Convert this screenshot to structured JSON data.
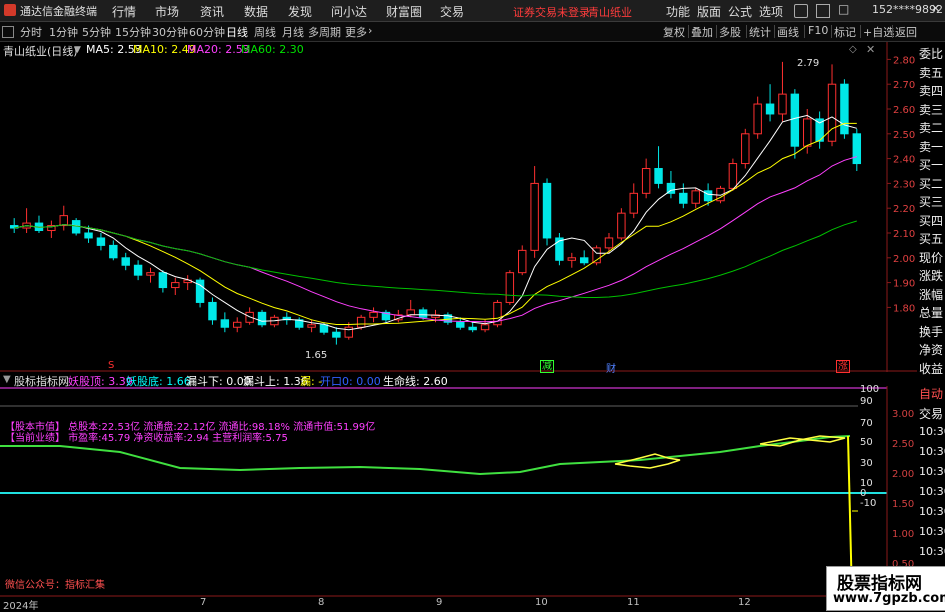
{
  "titlebar": {
    "app_name": "通达信金融终端",
    "menu": [
      "行情",
      "市场",
      "资讯",
      "数据",
      "发现",
      "问小达",
      "财富圈",
      "交易"
    ],
    "notice_login": "证券交易未登录",
    "notice_stock": "青山纸业",
    "right_menu": [
      "功能",
      "版面",
      "公式",
      "选项"
    ],
    "user": "152****9892"
  },
  "toolbar": {
    "periods": [
      "分时",
      "1分钟",
      "5分钟",
      "15分钟",
      "30分钟",
      "60分钟",
      "日线",
      "周线",
      "月线",
      "多周期",
      "更多"
    ],
    "active_period": "日线",
    "right_buttons": [
      "复权",
      "叠加",
      "多股",
      "统计",
      "画线",
      "F10",
      "标记",
      "+自选",
      "返回"
    ]
  },
  "main_chart": {
    "stock_title": "青山纸业(日线)",
    "ma_legend": [
      {
        "label": "MA5: 2.53",
        "color": "#ffffff"
      },
      {
        "label": "MA10: 2.49",
        "color": "#ffff00"
      },
      {
        "label": "MA20: 2.53",
        "color": "#ff40ff"
      },
      {
        "label": "MA60: 2.30",
        "color": "#00e000"
      }
    ],
    "price_axis": [
      "2.80",
      "2.70",
      "2.60",
      "2.50",
      "2.40",
      "2.30",
      "2.20",
      "2.10",
      "2.00",
      "1.90",
      "1.80"
    ],
    "max_marker": "2.79",
    "min_marker": "1.65",
    "markers": [
      {
        "text": "S",
        "color": "#ff3030"
      },
      {
        "text": "减",
        "color": "#30ff30"
      },
      {
        "text": "财",
        "color": "#5080ff"
      },
      {
        "text": "涨",
        "color": "#ff3030"
      }
    ]
  },
  "sub_chart": {
    "title": "股标指标网",
    "legend": [
      {
        "label": "妖股顶: 3.39",
        "color": "#ff40ff"
      },
      {
        "label": "妖股底: 1.66",
        "color": "#00ffff"
      },
      {
        "label": "漏斗下: 0.00",
        "color": "#ffffff"
      },
      {
        "label": "漏斗上: 1.36",
        "color": "#ffffff"
      },
      {
        "label": "漏: -",
        "color": "#ffff00"
      },
      {
        "label": "开口0: 0.00",
        "color": "#3060ff"
      },
      {
        "label": "生命线: 2.60",
        "color": "#ffffff"
      }
    ],
    "scale_left": [
      "100",
      "90",
      "70",
      "50",
      "30",
      "10",
      "0",
      "-10"
    ],
    "scale_right": [
      "3.00",
      "2.50",
      "2.00",
      "1.50",
      "1.00",
      "0.50"
    ],
    "info_lines": [
      "【股本市值】 总股本:22.53亿 流通盘:22.12亿 流通比:98.18% 流通市值:51.99亿",
      "【当前业绩】 市盈率:45.79 净资收益率:2.94 主营利润率:5.75"
    ],
    "footer_wechat": "微信公众号：指标汇集"
  },
  "right_panel": {
    "items": [
      "委比",
      "卖五",
      "卖四",
      "卖三",
      "卖二",
      "卖一",
      "买一",
      "买二",
      "买三",
      "买四",
      "买五",
      "现价",
      "涨跌",
      "涨幅",
      "总量",
      "换手",
      "净资",
      "收益"
    ],
    "lower_items": [
      "自动",
      "交易",
      "10:30",
      "10:30",
      "10:30",
      "10:30",
      "10:30",
      "10:30",
      "10:30",
      "10:30",
      "10:30"
    ]
  },
  "date_axis": [
    "2024年",
    "7",
    "8",
    "9",
    "10",
    "11",
    "12"
  ],
  "watermark": {
    "title": "股票指标网",
    "url": "www.7gpzb.com"
  },
  "chart_data": {
    "type": "candlestick",
    "title": "青山纸业(日线)",
    "ylim": [
      1.6,
      2.85
    ],
    "ohlc_approx": [
      [
        2.13,
        2.16,
        2.1,
        2.12
      ],
      [
        2.12,
        2.2,
        2.1,
        2.14
      ],
      [
        2.14,
        2.17,
        2.1,
        2.11
      ],
      [
        2.11,
        2.15,
        2.08,
        2.13
      ],
      [
        2.13,
        2.21,
        2.11,
        2.17
      ],
      [
        2.15,
        2.16,
        2.09,
        2.1
      ],
      [
        2.1,
        2.13,
        2.06,
        2.08
      ],
      [
        2.08,
        2.1,
        2.03,
        2.05
      ],
      [
        2.05,
        2.07,
        1.99,
        2.0
      ],
      [
        2.0,
        2.02,
        1.95,
        1.97
      ],
      [
        1.97,
        1.99,
        1.91,
        1.93
      ],
      [
        1.93,
        1.96,
        1.9,
        1.94
      ],
      [
        1.94,
        1.95,
        1.86,
        1.88
      ],
      [
        1.88,
        1.92,
        1.85,
        1.9
      ],
      [
        1.9,
        1.93,
        1.87,
        1.91
      ],
      [
        1.91,
        1.92,
        1.8,
        1.82
      ],
      [
        1.82,
        1.84,
        1.73,
        1.75
      ],
      [
        1.75,
        1.78,
        1.7,
        1.72
      ],
      [
        1.72,
        1.76,
        1.7,
        1.74
      ],
      [
        1.74,
        1.8,
        1.73,
        1.78
      ],
      [
        1.78,
        1.79,
        1.72,
        1.73
      ],
      [
        1.73,
        1.77,
        1.72,
        1.76
      ],
      [
        1.76,
        1.78,
        1.73,
        1.75
      ],
      [
        1.75,
        1.76,
        1.71,
        1.72
      ],
      [
        1.72,
        1.75,
        1.7,
        1.73
      ],
      [
        1.73,
        1.74,
        1.69,
        1.7
      ],
      [
        1.7,
        1.72,
        1.65,
        1.68
      ],
      [
        1.68,
        1.74,
        1.67,
        1.72
      ],
      [
        1.72,
        1.77,
        1.71,
        1.76
      ],
      [
        1.76,
        1.8,
        1.74,
        1.78
      ],
      [
        1.78,
        1.79,
        1.74,
        1.75
      ],
      [
        1.75,
        1.79,
        1.74,
        1.77
      ],
      [
        1.77,
        1.83,
        1.76,
        1.79
      ],
      [
        1.79,
        1.8,
        1.75,
        1.76
      ],
      [
        1.76,
        1.79,
        1.74,
        1.77
      ],
      [
        1.77,
        1.78,
        1.73,
        1.74
      ],
      [
        1.74,
        1.76,
        1.71,
        1.72
      ],
      [
        1.72,
        1.74,
        1.7,
        1.71
      ],
      [
        1.71,
        1.75,
        1.7,
        1.73
      ],
      [
        1.73,
        1.83,
        1.72,
        1.82
      ],
      [
        1.82,
        1.95,
        1.81,
        1.94
      ],
      [
        1.94,
        2.05,
        1.93,
        2.03
      ],
      [
        2.03,
        2.37,
        2.0,
        2.3
      ],
      [
        2.3,
        2.32,
        2.05,
        2.08
      ],
      [
        2.08,
        2.1,
        1.97,
        1.99
      ],
      [
        1.99,
        2.02,
        1.96,
        2.0
      ],
      [
        2.0,
        2.03,
        1.97,
        1.98
      ],
      [
        1.98,
        2.05,
        1.97,
        2.04
      ],
      [
        2.04,
        2.1,
        2.02,
        2.08
      ],
      [
        2.08,
        2.2,
        2.07,
        2.18
      ],
      [
        2.18,
        2.3,
        2.16,
        2.26
      ],
      [
        2.26,
        2.4,
        2.24,
        2.36
      ],
      [
        2.36,
        2.45,
        2.28,
        2.3
      ],
      [
        2.3,
        2.35,
        2.24,
        2.26
      ],
      [
        2.26,
        2.3,
        2.2,
        2.22
      ],
      [
        2.22,
        2.28,
        2.2,
        2.27
      ],
      [
        2.27,
        2.3,
        2.21,
        2.23
      ],
      [
        2.23,
        2.29,
        2.22,
        2.28
      ],
      [
        2.28,
        2.4,
        2.27,
        2.38
      ],
      [
        2.38,
        2.52,
        2.36,
        2.5
      ],
      [
        2.5,
        2.65,
        2.48,
        2.62
      ],
      [
        2.62,
        2.7,
        2.55,
        2.58
      ],
      [
        2.58,
        2.79,
        2.55,
        2.66
      ],
      [
        2.66,
        2.68,
        2.4,
        2.45
      ],
      [
        2.45,
        2.6,
        2.42,
        2.56
      ],
      [
        2.56,
        2.59,
        2.44,
        2.47
      ],
      [
        2.47,
        2.78,
        2.45,
        2.7
      ],
      [
        2.7,
        2.72,
        2.48,
        2.5
      ],
      [
        2.5,
        2.52,
        2.35,
        2.38
      ]
    ],
    "series": [
      {
        "name": "MA5",
        "value": 2.53
      },
      {
        "name": "MA10",
        "value": 2.49
      },
      {
        "name": "MA20",
        "value": 2.53
      },
      {
        "name": "MA60",
        "value": 2.3
      }
    ]
  }
}
